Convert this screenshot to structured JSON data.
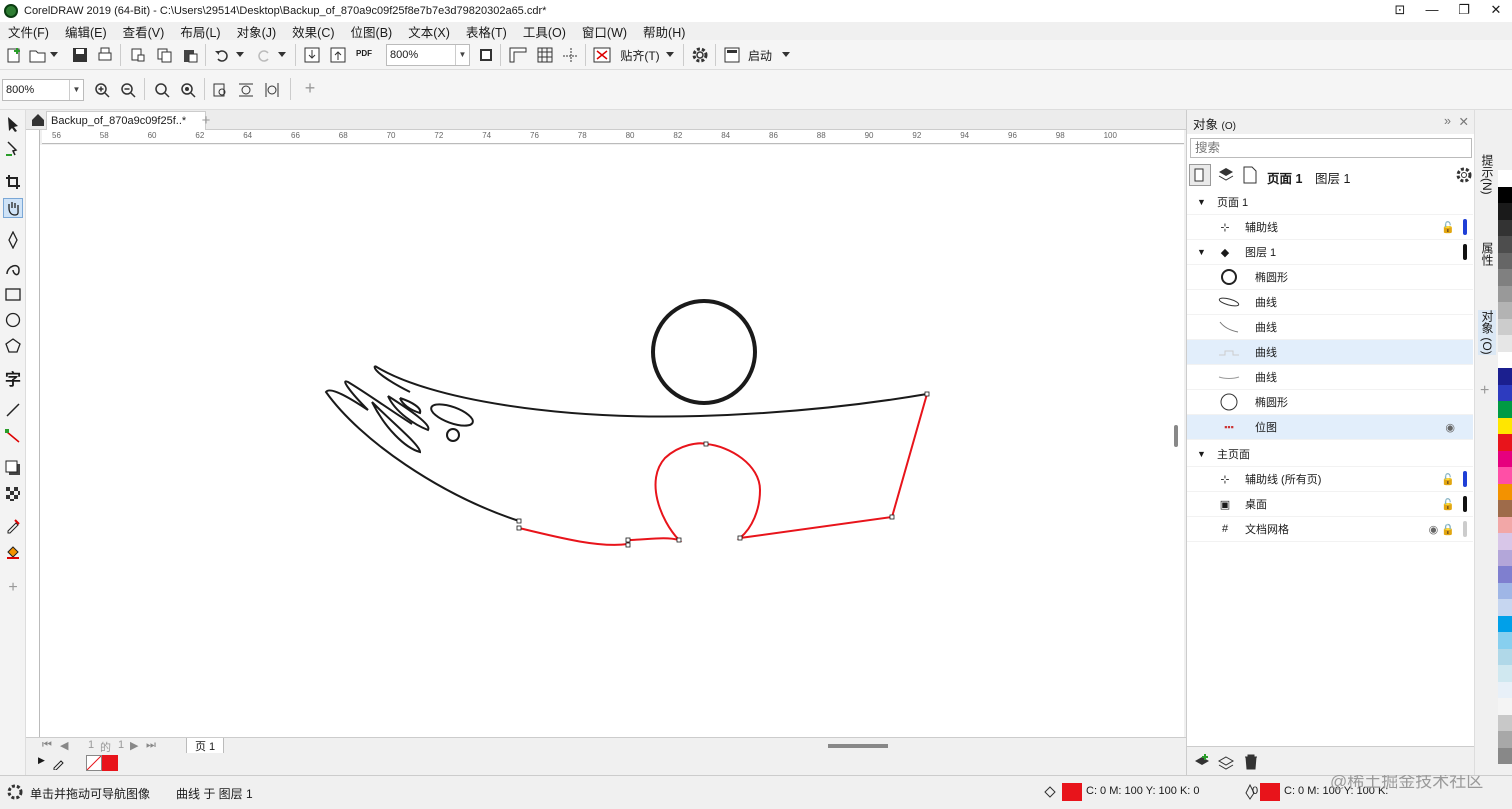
{
  "window": {
    "title": "CorelDRAW 2019 (64-Bit) - C:\\Users\\29514\\Desktop\\Backup_of_870a9c09f25f8e7b7e3d79820302a65.cdr*",
    "controls": [
      "⊡",
      "—",
      "❐",
      "✕"
    ]
  },
  "menu": [
    "文件(F)",
    "编辑(E)",
    "查看(V)",
    "布局(L)",
    "对象(J)",
    "效果(C)",
    "位图(B)",
    "文本(X)",
    "表格(T)",
    "工具(O)",
    "窗口(W)",
    "帮助(H)"
  ],
  "toolbar": {
    "zoom_value": "800%",
    "pdf_label": "PDF",
    "snap_label": "贴齐(T)",
    "launch_label": "启动"
  },
  "propertybar": {
    "zoom_value": "800%",
    "add_label": "+"
  },
  "document": {
    "tab_label": "Backup_of_870a9c09f25f..*",
    "ruler_ticks": [
      "56",
      "58",
      "60",
      "62",
      "64",
      "66",
      "68",
      "70",
      "72",
      "74",
      "76",
      "78",
      "80",
      "82",
      "84",
      "86",
      "88",
      "90",
      "92",
      "94",
      "96",
      "98",
      "100"
    ],
    "page_nav": {
      "current": "1",
      "of_label": "的",
      "total": "1",
      "page_tab": "页 1"
    }
  },
  "status": {
    "hint": "单击并拖动可导航图像",
    "selection": "曲线 于 图层 1",
    "fill_cmyk": "C: 0 M: 100 Y: 100 K: 0",
    "outline_width": "0",
    "outline_cmyk": "C: 0 M: 100 Y: 100 K:",
    "watermark": "@稀土掘金技术社区",
    "fill_color": "#e8141b"
  },
  "objects_panel": {
    "title": "对象",
    "title_key": "(O)",
    "search_placeholder": "搜索",
    "page_label": "页面 1",
    "layer_label": "图层 1",
    "rows": {
      "page1": "页面 1",
      "guides": "辅助线",
      "layer1": "图层 1",
      "ellipse1": "椭圆形",
      "curve1": "曲线",
      "curve2": "曲线",
      "curve3": "曲线",
      "curve4": "曲线",
      "ellipse2": "椭圆形",
      "bitmap": "位图",
      "master": "主页面",
      "guides_all": "辅助线 (所有页)",
      "desktop": "桌面",
      "docgrid": "文档网格"
    }
  },
  "side_tabs": {
    "hints": "提示(N)",
    "properties": "属性",
    "objects": "对象 (O)"
  },
  "palette": [
    "#ffffff",
    "#000000",
    "#1a1a1a",
    "#333333",
    "#4d4d4d",
    "#666666",
    "#808080",
    "#999999",
    "#b3b3b3",
    "#cccccc",
    "#e6e6e6",
    "#ffffff",
    "#1b1f8f",
    "#2d3bbf",
    "#009a44",
    "#ffe600",
    "#e8141b",
    "#e6007e",
    "#ff4fa6",
    "#f39200",
    "#9e6b4a",
    "#f2a7a7",
    "#d8c6e8",
    "#b3a6d9",
    "#7f7fcf",
    "#9fb6e6",
    "#c6d6f0",
    "#00a0e9",
    "#87cfef",
    "#b0d8e8",
    "#d0e8f0",
    "#e8f0f8",
    "#f4f4f4",
    "#c8c8c8",
    "#a8a8a8",
    "#888888"
  ]
}
